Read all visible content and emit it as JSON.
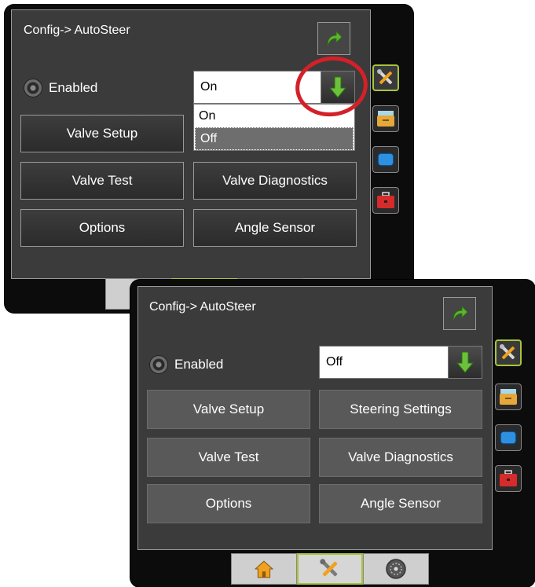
{
  "colors": {
    "accent_green": "#5db52e",
    "highlight_red": "#d42028",
    "panel_bg": "#3b3b3b"
  },
  "screen_before": {
    "title": "Config-> AutoSteer",
    "enabled_label": "Enabled",
    "enabled_value": "On",
    "dropdown_options": [
      "On",
      "Off"
    ],
    "buttons": {
      "valve_setup": "Valve Setup",
      "valve_test": "Valve Test",
      "valve_diagnostics": "Valve Diagnostics",
      "options": "Options",
      "angle_sensor": "Angle Sensor"
    },
    "side_tabs": [
      "tools-icon",
      "folder-icon",
      "monitor-icon",
      "toolbox-icon"
    ]
  },
  "screen_after": {
    "title": "Config-> AutoSteer",
    "enabled_label": "Enabled",
    "enabled_value": "Off",
    "buttons": {
      "valve_setup": "Valve Setup",
      "steering_settings": "Steering Settings",
      "valve_test": "Valve Test",
      "valve_diagnostics": "Valve Diagnostics",
      "options": "Options",
      "angle_sensor": "Angle Sensor"
    },
    "side_tabs": [
      "tools-icon",
      "folder-icon",
      "monitor-icon",
      "toolbox-icon"
    ],
    "bottom_tabs": [
      "home-icon",
      "tools-icon",
      "gauge-icon"
    ]
  }
}
